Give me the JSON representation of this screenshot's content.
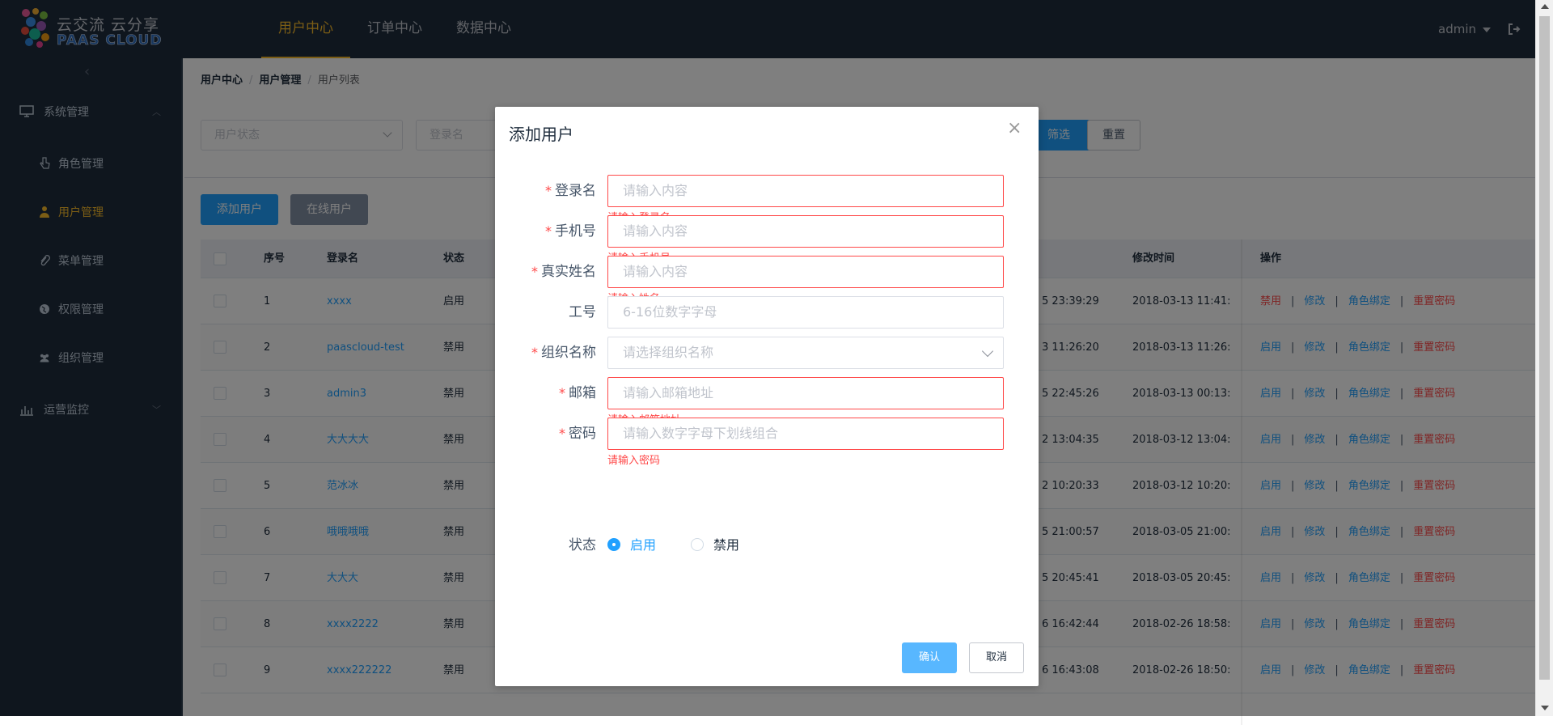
{
  "header": {
    "logo_line1": "云交流 云分享",
    "logo_line2": "PAAS CLOUD",
    "nav": [
      "用户中心",
      "订单中心",
      "数据中心"
    ],
    "user": "admin"
  },
  "sidebar": {
    "groups": [
      {
        "label": "系统管理",
        "icon": "monitor-icon"
      },
      {
        "label": "运营监控",
        "icon": "bar-chart-icon"
      }
    ],
    "items": [
      {
        "label": "角色管理",
        "icon": "hand-pointer-icon"
      },
      {
        "label": "用户管理",
        "icon": "user-icon"
      },
      {
        "label": "菜单管理",
        "icon": "paperclip-icon"
      },
      {
        "label": "权限管理",
        "icon": "globe-icon"
      },
      {
        "label": "组织管理",
        "icon": "users-icon"
      }
    ]
  },
  "breadcrumb": [
    "用户中心",
    "用户管理",
    "用户列表"
  ],
  "filters": {
    "status_placeholder": "用户状态",
    "login_placeholder": "登录名",
    "search_label": "筛选",
    "reset_label": "重置"
  },
  "toolbar": {
    "add_label": "添加用户",
    "online_label": "在线用户"
  },
  "table": {
    "columns": {
      "index": "序号",
      "login": "登录名",
      "status": "状态",
      "modified": "修改时间",
      "actions": "操作"
    },
    "rows": [
      {
        "index": "1",
        "login": "xxxx",
        "status": "启用",
        "created": "5 23:39:29",
        "modified": "2018-03-13 11:41:",
        "toggle": "禁用"
      },
      {
        "index": "2",
        "login": "paascloud-test",
        "status": "禁用",
        "created": "3 11:26:20",
        "modified": "2018-03-13 11:26:",
        "toggle": "启用"
      },
      {
        "index": "3",
        "login": "admin3",
        "status": "禁用",
        "created": "5 22:45:26",
        "modified": "2018-03-13 00:13:",
        "toggle": "启用"
      },
      {
        "index": "4",
        "login": "大大大大",
        "status": "禁用",
        "created": "2 13:04:35",
        "modified": "2018-03-12 13:04:",
        "toggle": "启用"
      },
      {
        "index": "5",
        "login": "范冰冰",
        "status": "禁用",
        "created": "2 10:20:33",
        "modified": "2018-03-12 10:20:",
        "toggle": "启用"
      },
      {
        "index": "6",
        "login": "哦哦哦哦",
        "status": "禁用",
        "created": "5 21:00:57",
        "modified": "2018-03-05 21:00:",
        "toggle": "启用"
      },
      {
        "index": "7",
        "login": "大大大",
        "status": "禁用",
        "created": "5 20:45:41",
        "modified": "2018-03-05 20:45:",
        "toggle": "启用"
      },
      {
        "index": "8",
        "login": "xxxx2222",
        "status": "禁用",
        "created": "6 16:42:44",
        "modified": "2018-02-26 18:58:",
        "toggle": "启用"
      },
      {
        "index": "9",
        "login": "xxxx222222",
        "status": "禁用",
        "created": "6 16:43:08",
        "modified": "2018-02-26 18:50:",
        "toggle": "启用"
      }
    ],
    "row_actions": {
      "edit": "修改",
      "bind": "角色绑定",
      "reset_pwd": "重置密码"
    }
  },
  "dialog": {
    "title": "添加用户",
    "fields": [
      {
        "label": "登录名",
        "required": true,
        "placeholder": "请输入内容",
        "error": "请输入登录名"
      },
      {
        "label": "手机号",
        "required": true,
        "placeholder": "请输入内容",
        "error": "请输入手机号"
      },
      {
        "label": "真实姓名",
        "required": true,
        "placeholder": "请输入内容",
        "error": "请输入姓名"
      },
      {
        "label": "工号",
        "required": false,
        "placeholder": "6-16位数字字母",
        "error": ""
      },
      {
        "label": "组织名称",
        "required": true,
        "placeholder": "请选择组织名称",
        "error": ""
      },
      {
        "label": "邮箱",
        "required": true,
        "placeholder": "请输入邮箱地址",
        "error": "请输入邮箱地址"
      },
      {
        "label": "密码",
        "required": true,
        "placeholder": "请输入数字字母下划线组合",
        "error": "请输入密码"
      }
    ],
    "status_label": "状态",
    "status_options": [
      "启用",
      "禁用"
    ],
    "status_selected": "启用",
    "confirm": "确认",
    "cancel": "取消"
  },
  "colors": {
    "accent": "#20a0ff",
    "nav_active": "#f7ba2a",
    "error": "#ff4949",
    "sidebar_bg": "#1f2d3d"
  }
}
